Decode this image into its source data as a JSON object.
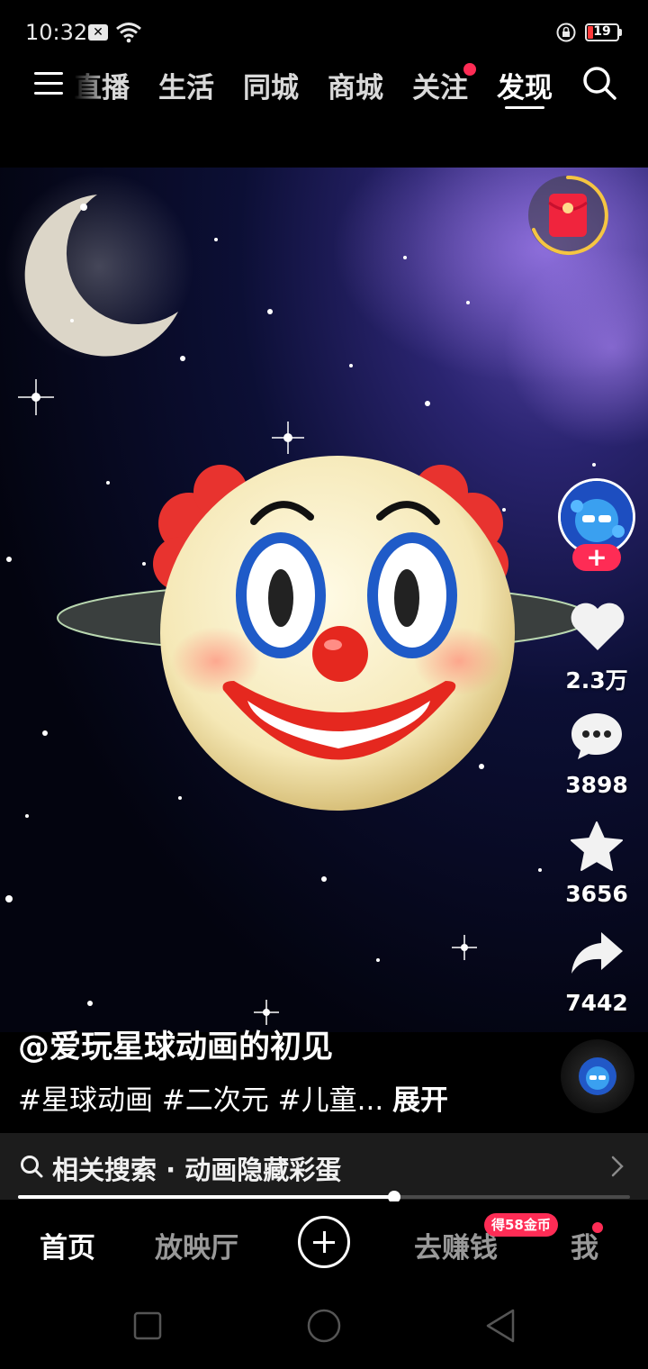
{
  "status_bar": {
    "time": "10:32",
    "battery": "19"
  },
  "top_nav": {
    "tabs": [
      "直播",
      "生活",
      "同城",
      "商城",
      "关注",
      "发现"
    ],
    "active_tab": "发现"
  },
  "video": {
    "author": "@爱玩星球动画的初见",
    "caption": "#星球动画 #二次元 #儿童...",
    "expand_label": "展开"
  },
  "actions": {
    "likes": "2.3万",
    "comments": "3898",
    "favorites": "3656",
    "shares": "7442"
  },
  "related_search": {
    "text": "相关搜索 · 动画隐藏彩蛋"
  },
  "progress": {
    "fraction": 0.615
  },
  "bottom_tabs": {
    "home": "首页",
    "theater": "放映厅",
    "earn": "去赚钱",
    "earn_badge": "得58金币",
    "me": "我"
  },
  "colors": {
    "accent": "#fe2c55",
    "background": "#000000"
  },
  "icons": [
    "menu-icon",
    "search-icon",
    "heart-icon",
    "comment-icon",
    "star-icon",
    "share-icon",
    "plus-icon",
    "red-packet-icon"
  ]
}
